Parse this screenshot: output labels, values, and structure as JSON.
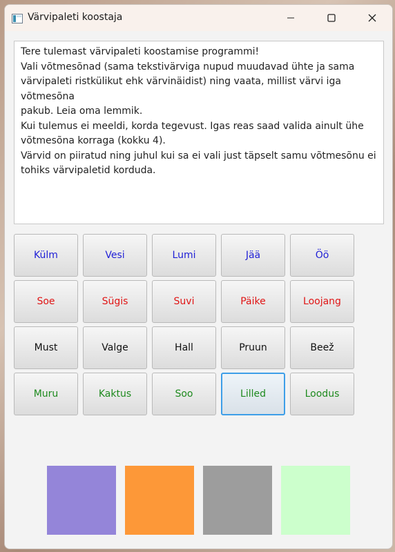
{
  "window": {
    "title": "Värvipaleti koostaja"
  },
  "instructions": "Tere tulemast värvipaleti koostamise programmi!\nVali võtmesõnad (sama tekstivärviga nupud muudavad ühte ja sama\nvärvipaleti ristkülikut ehk värvinäidist) ning vaata, millist värvi iga võtmesõna\npakub. Leia oma lemmik.\nKui tulemus ei meeldi, korda tegevust. Igas reas saad valida ainult ühe\nvõtmesõna korraga (kokku 4).\nVärvid on piiratud ning juhul kui sa ei vali just täpselt samu võtmesõnu ei\ntohiks värvipaletid korduda.",
  "rows": [
    {
      "color": "#1f1fd6",
      "buttons": [
        "Külm",
        "Vesi",
        "Lumi",
        "Jää",
        "Öö"
      ]
    },
    {
      "color": "#e01515",
      "buttons": [
        "Soe",
        "Sügis",
        "Suvi",
        "Päike",
        "Loojang"
      ]
    },
    {
      "color": "#111111",
      "buttons": [
        "Must",
        "Valge",
        "Hall",
        "Pruun",
        "Beež"
      ]
    },
    {
      "color": "#1e8a1e",
      "buttons": [
        "Muru",
        "Kaktus",
        "Soo",
        "Lilled",
        "Loodus"
      ]
    }
  ],
  "focused_button": "Lilled",
  "swatches": [
    "#9485d9",
    "#fd9838",
    "#9d9d9d",
    "#ccffcc"
  ]
}
